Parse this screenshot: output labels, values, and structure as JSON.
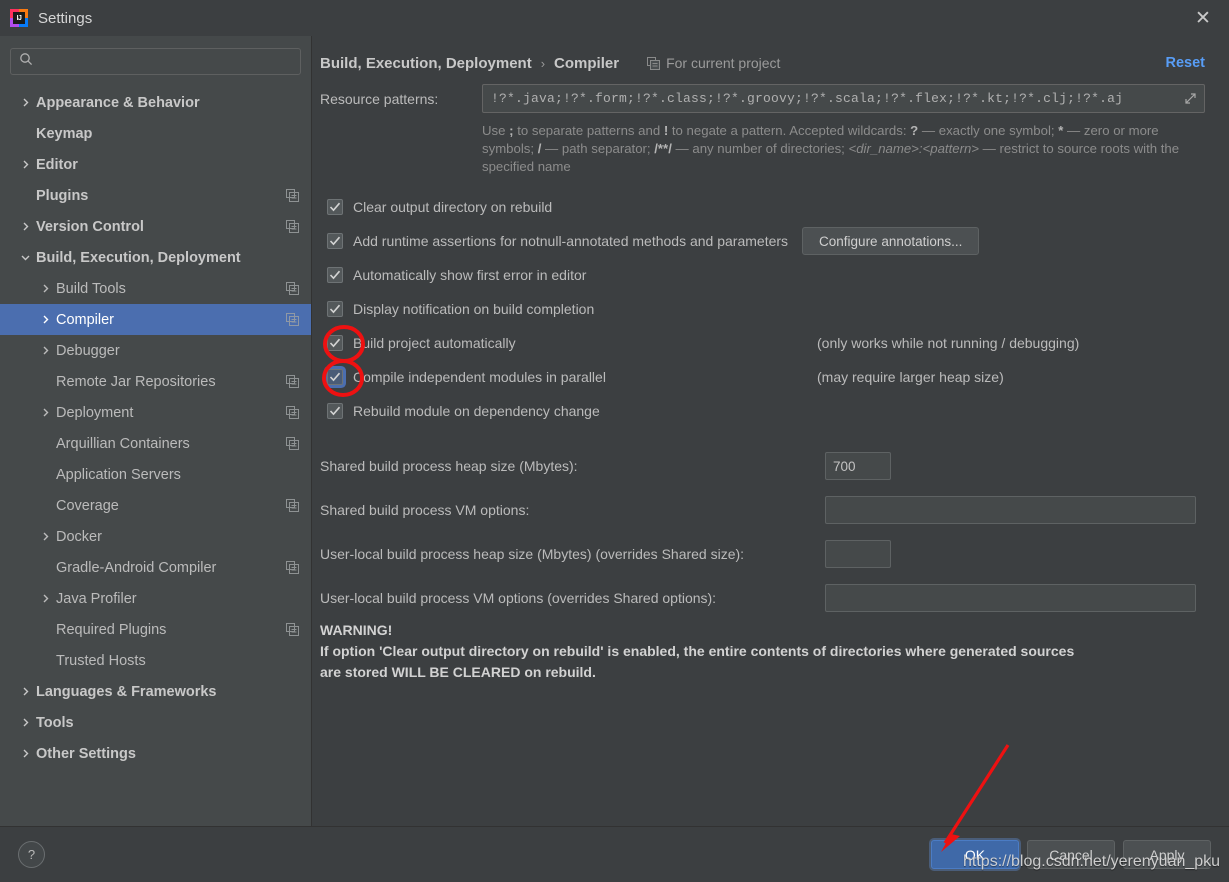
{
  "window": {
    "title": "Settings",
    "logo_text": "IJ",
    "close_label": "✕"
  },
  "sidebar": {
    "search": {
      "value": "",
      "placeholder": ""
    },
    "items": [
      {
        "label": "Appearance & Behavior",
        "level": 0,
        "bold": true,
        "arrow": "collapsed",
        "badge": false,
        "selected": false
      },
      {
        "label": "Keymap",
        "level": 0,
        "bold": true,
        "arrow": "none",
        "badge": false,
        "selected": false
      },
      {
        "label": "Editor",
        "level": 0,
        "bold": true,
        "arrow": "collapsed",
        "badge": false,
        "selected": false
      },
      {
        "label": "Plugins",
        "level": 0,
        "bold": true,
        "arrow": "none",
        "badge": true,
        "selected": false
      },
      {
        "label": "Version Control",
        "level": 0,
        "bold": true,
        "arrow": "collapsed",
        "badge": true,
        "selected": false
      },
      {
        "label": "Build, Execution, Deployment",
        "level": 0,
        "bold": true,
        "arrow": "expanded",
        "badge": false,
        "selected": false
      },
      {
        "label": "Build Tools",
        "level": 1,
        "bold": false,
        "arrow": "collapsed",
        "badge": true,
        "selected": false
      },
      {
        "label": "Compiler",
        "level": 1,
        "bold": false,
        "arrow": "collapsed",
        "badge": true,
        "selected": true
      },
      {
        "label": "Debugger",
        "level": 1,
        "bold": false,
        "arrow": "collapsed",
        "badge": false,
        "selected": false
      },
      {
        "label": "Remote Jar Repositories",
        "level": 1,
        "bold": false,
        "arrow": "none",
        "badge": true,
        "selected": false
      },
      {
        "label": "Deployment",
        "level": 1,
        "bold": false,
        "arrow": "collapsed",
        "badge": true,
        "selected": false
      },
      {
        "label": "Arquillian Containers",
        "level": 1,
        "bold": false,
        "arrow": "none",
        "badge": true,
        "selected": false
      },
      {
        "label": "Application Servers",
        "level": 1,
        "bold": false,
        "arrow": "none",
        "badge": false,
        "selected": false
      },
      {
        "label": "Coverage",
        "level": 1,
        "bold": false,
        "arrow": "none",
        "badge": true,
        "selected": false
      },
      {
        "label": "Docker",
        "level": 1,
        "bold": false,
        "arrow": "collapsed",
        "badge": false,
        "selected": false
      },
      {
        "label": "Gradle-Android Compiler",
        "level": 1,
        "bold": false,
        "arrow": "none",
        "badge": true,
        "selected": false
      },
      {
        "label": "Java Profiler",
        "level": 1,
        "bold": false,
        "arrow": "collapsed",
        "badge": false,
        "selected": false
      },
      {
        "label": "Required Plugins",
        "level": 1,
        "bold": false,
        "arrow": "none",
        "badge": true,
        "selected": false
      },
      {
        "label": "Trusted Hosts",
        "level": 1,
        "bold": false,
        "arrow": "none",
        "badge": false,
        "selected": false
      },
      {
        "label": "Languages & Frameworks",
        "level": 0,
        "bold": true,
        "arrow": "collapsed",
        "badge": false,
        "selected": false
      },
      {
        "label": "Tools",
        "level": 0,
        "bold": true,
        "arrow": "collapsed",
        "badge": false,
        "selected": false
      },
      {
        "label": "Other Settings",
        "level": 0,
        "bold": true,
        "arrow": "collapsed",
        "badge": false,
        "selected": false
      }
    ]
  },
  "header": {
    "breadcrumb_root": "Build, Execution, Deployment",
    "breadcrumb_sep": "›",
    "breadcrumb_leaf": "Compiler",
    "scope_label": "For current project",
    "reset_label": "Reset"
  },
  "form": {
    "resource_patterns": {
      "label": "Resource patterns:",
      "value": "!?*.java;!?*.form;!?*.class;!?*.groovy;!?*.scala;!?*.flex;!?*.kt;!?*.clj;!?*.aj"
    },
    "hint_parts": {
      "p1": "Use ",
      "b1": ";",
      "p2": " to separate patterns and ",
      "b2": "!",
      "p3": " to negate a pattern. Accepted wildcards: ",
      "b3": "?",
      "p4": " — exactly one symbol; ",
      "b4": "*",
      "p5": " — zero or more symbols; ",
      "b5": "/",
      "p6": " — path separator; ",
      "b6": "/**/",
      "p7": " — any number of directories; ",
      "i1": "<dir_name>:<pattern>",
      "p8": " — restrict to source roots with the specified name"
    },
    "checkboxes": [
      {
        "label": "Clear output directory on rebuild",
        "checked": true,
        "focused": false,
        "note": "",
        "button": ""
      },
      {
        "label": "Add runtime assertions for notnull-annotated methods and parameters",
        "checked": true,
        "focused": false,
        "note": "",
        "button": "Configure annotations..."
      },
      {
        "label": "Automatically show first error in editor",
        "checked": true,
        "focused": false,
        "note": "",
        "button": ""
      },
      {
        "label": "Display notification on build completion",
        "checked": true,
        "focused": false,
        "note": "",
        "button": ""
      },
      {
        "label": "Build project automatically",
        "checked": true,
        "focused": false,
        "note": "(only works while not running / debugging)",
        "button": ""
      },
      {
        "label": "Compile independent modules in parallel",
        "checked": true,
        "focused": true,
        "note": "(may require larger heap size)",
        "button": ""
      },
      {
        "label": "Rebuild module on dependency change",
        "checked": true,
        "focused": false,
        "note": "",
        "button": ""
      }
    ],
    "fields": [
      {
        "label": "Shared build process heap size (Mbytes):",
        "value": "700",
        "size": "small"
      },
      {
        "label": "Shared build process VM options:",
        "value": "",
        "size": "wide"
      },
      {
        "label": "User-local build process heap size (Mbytes) (overrides Shared size):",
        "value": "",
        "size": "small"
      },
      {
        "label": "User-local build process VM options (overrides Shared options):",
        "value": "",
        "size": "wide"
      }
    ],
    "warning": {
      "title": "WARNING!",
      "line1": "If option 'Clear output directory on rebuild' is enabled, the entire contents of directories where generated sources",
      "line2": "are stored WILL BE CLEARED on rebuild."
    }
  },
  "footer": {
    "help_label": "?",
    "ok_label": "OK",
    "cancel_label": "Cancel",
    "apply_label": "Apply"
  },
  "annotations": {
    "watermark": "https://blog.csdn.net/yerenyuan_pku",
    "accent_red": "#ee1111",
    "accent_blue": "#589df6",
    "selection_blue": "#4b6eaf"
  }
}
